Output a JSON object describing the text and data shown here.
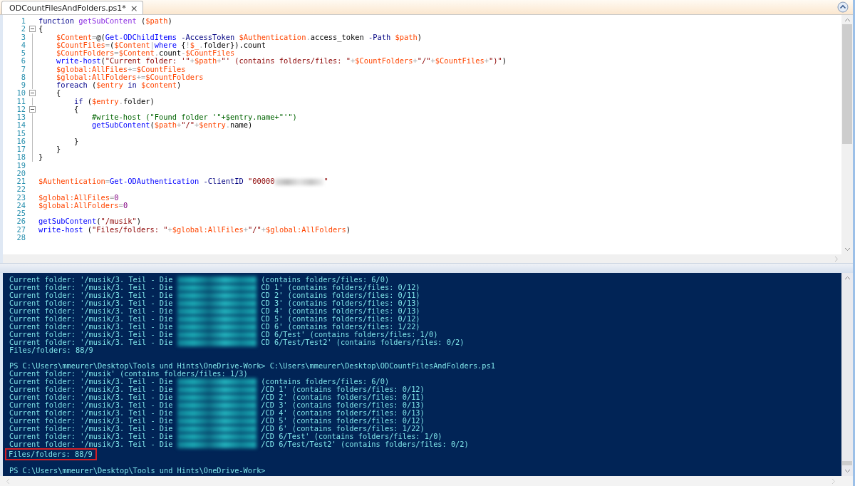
{
  "tab": {
    "title": "ODCountFilesAndFolders.ps1*",
    "close": "×",
    "selected": true
  },
  "editor": {
    "lines": [
      {
        "number": "1",
        "collapsible": false,
        "fold_guide": false,
        "tokens": [
          {
            "kind": "keyword",
            "text": "function "
          },
          {
            "kind": "function",
            "text": "getSubContent"
          },
          {
            "kind": "plain",
            "text": " ("
          },
          {
            "kind": "variable",
            "text": "$path"
          },
          {
            "kind": "plain",
            "text": ")"
          }
        ]
      },
      {
        "number": "2",
        "collapsible": true,
        "fold_guide": false,
        "tokens": [
          {
            "kind": "plain",
            "text": "{"
          }
        ]
      },
      {
        "number": "3",
        "collapsible": false,
        "fold_guide": true,
        "tokens": [
          {
            "kind": "variable",
            "text": "    $Content"
          },
          {
            "kind": "operator",
            "text": "="
          },
          {
            "kind": "plain",
            "text": "@("
          },
          {
            "kind": "command",
            "text": "Get-ODChildItems "
          },
          {
            "kind": "parameter",
            "text": "-AccessToken "
          },
          {
            "kind": "variable",
            "text": "$Authentication"
          },
          {
            "kind": "operator",
            "text": "."
          },
          {
            "kind": "plain",
            "text": "access_token "
          },
          {
            "kind": "parameter",
            "text": "-Path "
          },
          {
            "kind": "variable",
            "text": "$path"
          },
          {
            "kind": "plain",
            "text": ")"
          }
        ]
      },
      {
        "number": "4",
        "collapsible": false,
        "fold_guide": true,
        "tokens": [
          {
            "kind": "variable",
            "text": "    $CountFiles"
          },
          {
            "kind": "operator",
            "text": "="
          },
          {
            "kind": "plain",
            "text": "("
          },
          {
            "kind": "variable",
            "text": "$Content"
          },
          {
            "kind": "operator",
            "text": "|"
          },
          {
            "kind": "command",
            "text": "where"
          },
          {
            "kind": "plain",
            "text": " {"
          },
          {
            "kind": "operator",
            "text": "!"
          },
          {
            "kind": "variable",
            "text": "$_"
          },
          {
            "kind": "operator",
            "text": "."
          },
          {
            "kind": "plain",
            "text": "folder}).count"
          }
        ]
      },
      {
        "number": "5",
        "collapsible": false,
        "fold_guide": true,
        "tokens": [
          {
            "kind": "variable",
            "text": "    $CountFolders"
          },
          {
            "kind": "operator",
            "text": "="
          },
          {
            "kind": "variable",
            "text": "$Content"
          },
          {
            "kind": "operator",
            "text": "."
          },
          {
            "kind": "plain",
            "text": "count"
          },
          {
            "kind": "operator",
            "text": "-"
          },
          {
            "kind": "variable",
            "text": "$CountFiles"
          }
        ]
      },
      {
        "number": "6",
        "collapsible": false,
        "fold_guide": true,
        "tokens": [
          {
            "kind": "command",
            "text": "    write-host"
          },
          {
            "kind": "plain",
            "text": "("
          },
          {
            "kind": "string",
            "text": "\"Current folder: '\""
          },
          {
            "kind": "operator",
            "text": "+"
          },
          {
            "kind": "variable",
            "text": "$path"
          },
          {
            "kind": "operator",
            "text": "+"
          },
          {
            "kind": "string",
            "text": "\"' (contains folders/files: \""
          },
          {
            "kind": "operator",
            "text": "+"
          },
          {
            "kind": "variable",
            "text": "$CountFolders"
          },
          {
            "kind": "operator",
            "text": "+"
          },
          {
            "kind": "string",
            "text": "\"/\""
          },
          {
            "kind": "operator",
            "text": "+"
          },
          {
            "kind": "variable",
            "text": "$CountFiles"
          },
          {
            "kind": "operator",
            "text": "+"
          },
          {
            "kind": "string",
            "text": "\")\""
          },
          {
            "kind": "plain",
            "text": ")"
          }
        ]
      },
      {
        "number": "7",
        "collapsible": false,
        "fold_guide": true,
        "tokens": [
          {
            "kind": "variable",
            "text": "    $global:AllFiles"
          },
          {
            "kind": "operator",
            "text": "+="
          },
          {
            "kind": "variable",
            "text": "$CountFiles"
          }
        ]
      },
      {
        "number": "8",
        "collapsible": false,
        "fold_guide": true,
        "tokens": [
          {
            "kind": "variable",
            "text": "    $global:AllFolders"
          },
          {
            "kind": "operator",
            "text": "+="
          },
          {
            "kind": "variable",
            "text": "$CountFolders"
          }
        ]
      },
      {
        "number": "9",
        "collapsible": false,
        "fold_guide": true,
        "tokens": [
          {
            "kind": "keyword",
            "text": "    foreach"
          },
          {
            "kind": "plain",
            "text": " ("
          },
          {
            "kind": "variable",
            "text": "$entry"
          },
          {
            "kind": "keyword",
            "text": " in "
          },
          {
            "kind": "variable",
            "text": "$content"
          },
          {
            "kind": "plain",
            "text": ")"
          }
        ]
      },
      {
        "number": "10",
        "collapsible": true,
        "fold_guide": false,
        "tokens": [
          {
            "kind": "plain",
            "text": "    {"
          }
        ]
      },
      {
        "number": "11",
        "collapsible": false,
        "fold_guide": true,
        "tokens": [
          {
            "kind": "keyword",
            "text": "        if"
          },
          {
            "kind": "plain",
            "text": " ("
          },
          {
            "kind": "variable",
            "text": "$entry"
          },
          {
            "kind": "operator",
            "text": "."
          },
          {
            "kind": "plain",
            "text": "folder)"
          }
        ]
      },
      {
        "number": "12",
        "collapsible": true,
        "fold_guide": false,
        "tokens": [
          {
            "kind": "plain",
            "text": "        {"
          }
        ]
      },
      {
        "number": "13",
        "collapsible": false,
        "fold_guide": true,
        "tokens": [
          {
            "kind": "comment",
            "text": "            #write-host (\"Found folder '\"+$entry.name+\"'\")"
          }
        ]
      },
      {
        "number": "14",
        "collapsible": false,
        "fold_guide": true,
        "tokens": [
          {
            "kind": "command",
            "text": "            getSubContent"
          },
          {
            "kind": "plain",
            "text": "("
          },
          {
            "kind": "variable",
            "text": "$path"
          },
          {
            "kind": "operator",
            "text": "+"
          },
          {
            "kind": "string",
            "text": "\"/\""
          },
          {
            "kind": "operator",
            "text": "+"
          },
          {
            "kind": "variable",
            "text": "$entry"
          },
          {
            "kind": "operator",
            "text": "."
          },
          {
            "kind": "plain",
            "text": "name)"
          }
        ]
      },
      {
        "number": "15",
        "collapsible": false,
        "fold_guide": true
      },
      {
        "number": "16",
        "collapsible": false,
        "fold_guide": true,
        "tokens": [
          {
            "kind": "plain",
            "text": "        }"
          }
        ]
      },
      {
        "number": "17",
        "collapsible": false,
        "fold_guide": true,
        "tokens": [
          {
            "kind": "plain",
            "text": "    }"
          }
        ]
      },
      {
        "number": "18",
        "collapsible": false,
        "fold_guide": true,
        "tokens": [
          {
            "kind": "plain",
            "text": "}"
          }
        ]
      },
      {
        "number": "19",
        "collapsible": false,
        "fold_guide": false
      },
      {
        "number": "20",
        "collapsible": false,
        "fold_guide": false
      },
      {
        "number": "21",
        "collapsible": false,
        "fold_guide": false,
        "tokens": [
          {
            "kind": "variable",
            "text": "$Authentication"
          },
          {
            "kind": "operator",
            "text": "="
          },
          {
            "kind": "command",
            "text": "Get-ODAuthentication "
          },
          {
            "kind": "parameter",
            "text": "-ClientID "
          },
          {
            "kind": "string",
            "text": "\"00000"
          },
          {
            "kind": "redacted"
          },
          {
            "kind": "string",
            "text": "\""
          }
        ]
      },
      {
        "number": "22",
        "collapsible": false,
        "fold_guide": false
      },
      {
        "number": "23",
        "collapsible": false,
        "fold_guide": false,
        "tokens": [
          {
            "kind": "variable",
            "text": "$global:AllFiles"
          },
          {
            "kind": "operator",
            "text": "="
          },
          {
            "kind": "number",
            "text": "0"
          }
        ]
      },
      {
        "number": "24",
        "collapsible": false,
        "fold_guide": false,
        "tokens": [
          {
            "kind": "variable",
            "text": "$global:AllFolders"
          },
          {
            "kind": "operator",
            "text": "="
          },
          {
            "kind": "number",
            "text": "0"
          }
        ]
      },
      {
        "number": "25",
        "collapsible": false,
        "fold_guide": false
      },
      {
        "number": "26",
        "collapsible": false,
        "fold_guide": false,
        "tokens": [
          {
            "kind": "command",
            "text": "getSubContent"
          },
          {
            "kind": "plain",
            "text": "("
          },
          {
            "kind": "string",
            "text": "\"/musik\""
          },
          {
            "kind": "plain",
            "text": ")"
          }
        ]
      },
      {
        "number": "27",
        "collapsible": false,
        "fold_guide": false,
        "tokens": [
          {
            "kind": "command",
            "text": "write-host"
          },
          {
            "kind": "plain",
            "text": " ("
          },
          {
            "kind": "string",
            "text": "\"Files/folders: \""
          },
          {
            "kind": "operator",
            "text": "+"
          },
          {
            "kind": "variable",
            "text": "$global:AllFiles"
          },
          {
            "kind": "operator",
            "text": "+"
          },
          {
            "kind": "string",
            "text": "\"/\""
          },
          {
            "kind": "operator",
            "text": "+"
          },
          {
            "kind": "variable",
            "text": "$global:AllFolders"
          },
          {
            "kind": "plain",
            "text": ")"
          }
        ]
      },
      {
        "number": "28",
        "collapsible": false,
        "fold_guide": false
      }
    ]
  },
  "console": {
    "lines": [
      {
        "kind": "redacted",
        "text": "Current folder: '/musik/3. Teil - Die",
        "rest": "(contains folders/files: 6/0)",
        "highlighted": false
      },
      {
        "kind": "redacted",
        "text": "Current folder: '/musik/3. Teil - Die",
        "rest": "CD 1' (contains folders/files: 0/12)",
        "highlighted": false
      },
      {
        "kind": "redacted",
        "text": "Current folder: '/musik/3. Teil - Die",
        "rest": "CD 2' (contains folders/files: 0/11)",
        "highlighted": false
      },
      {
        "kind": "redacted",
        "text": "Current folder: '/musik/3. Teil - Die",
        "rest": "CD 3' (contains folders/files: 0/13)",
        "highlighted": false
      },
      {
        "kind": "redacted",
        "text": "Current folder: '/musik/3. Teil - Die",
        "rest": "CD 4' (contains folders/files: 0/13)",
        "highlighted": false
      },
      {
        "kind": "redacted",
        "text": "Current folder: '/musik/3. Teil - Die",
        "rest": "CD 5' (contains folders/files: 0/12)",
        "highlighted": false
      },
      {
        "kind": "redacted",
        "text": "Current folder: '/musik/3. Teil - Die",
        "rest": "CD 6' (contains folders/files: 1/22)",
        "highlighted": false
      },
      {
        "kind": "redacted",
        "text": "Current folder: '/musik/3. Teil - Die",
        "rest": "CD 6/Test' (contains folders/files: 1/0)",
        "highlighted": false
      },
      {
        "kind": "redacted",
        "text": "Current folder: '/musik/3. Teil - Die",
        "rest": "CD 6/Test/Test2' (contains folders/files: 0/2)",
        "highlighted": false
      },
      {
        "kind": "output",
        "text": "Files/folders: 88/9",
        "highlighted": false
      },
      {
        "kind": "blank"
      },
      {
        "kind": "output",
        "text": "PS C:\\Users\\mmeurer\\Desktop\\Tools und Hints\\OneDrive-Work> C:\\Users\\mmeurer\\Desktop\\ODCountFilesAndFolders.ps1",
        "highlighted": false
      },
      {
        "kind": "output",
        "text": "Current folder: '/musik' (contains folders/files: 1/3)",
        "highlighted": false
      },
      {
        "kind": "redacted",
        "text": "Current folder: '/musik/3. Teil - Die",
        "rest": "(contains folders/files: 6/0)",
        "highlighted": false
      },
      {
        "kind": "redacted",
        "text": "Current folder: '/musik/3. Teil - Die",
        "rest": "/CD 1' (contains folders/files: 0/12)",
        "highlighted": false
      },
      {
        "kind": "redacted",
        "text": "Current folder: '/musik/3. Teil - Die",
        "rest": "/CD 2' (contains folders/files: 0/11)",
        "highlighted": false
      },
      {
        "kind": "redacted",
        "text": "Current folder: '/musik/3. Teil - Die",
        "rest": "/CD 3' (contains folders/files: 0/13)",
        "highlighted": false
      },
      {
        "kind": "redacted",
        "text": "Current folder: '/musik/3. Teil - Die",
        "rest": "/CD 4' (contains folders/files: 0/13)",
        "highlighted": false
      },
      {
        "kind": "redacted",
        "text": "Current folder: '/musik/3. Teil - Die",
        "rest": "/CD 5' (contains folders/files: 0/12)",
        "highlighted": false
      },
      {
        "kind": "redacted",
        "text": "Current folder: '/musik/3. Teil - Die",
        "rest": "/CD 6' (contains folders/files: 1/22)",
        "highlighted": false
      },
      {
        "kind": "redacted",
        "text": "Current folder: '/musik/3. Teil - Die",
        "rest": "/CD 6/Test' (contains folders/files: 1/0)",
        "highlighted": false
      },
      {
        "kind": "redacted",
        "text": "Current folder: '/musik/3. Teil - Die",
        "rest": "/CD 6/Test/Test2' (contains folders/files: 0/2)",
        "highlighted": false
      },
      {
        "kind": "output",
        "text": "Files/folders: 88/9",
        "highlighted": true
      },
      {
        "kind": "blank"
      },
      {
        "kind": "output",
        "text": "PS C:\\Users\\mmeurer\\Desktop\\Tools und Hints\\OneDrive-Work>",
        "highlighted": false
      }
    ]
  }
}
